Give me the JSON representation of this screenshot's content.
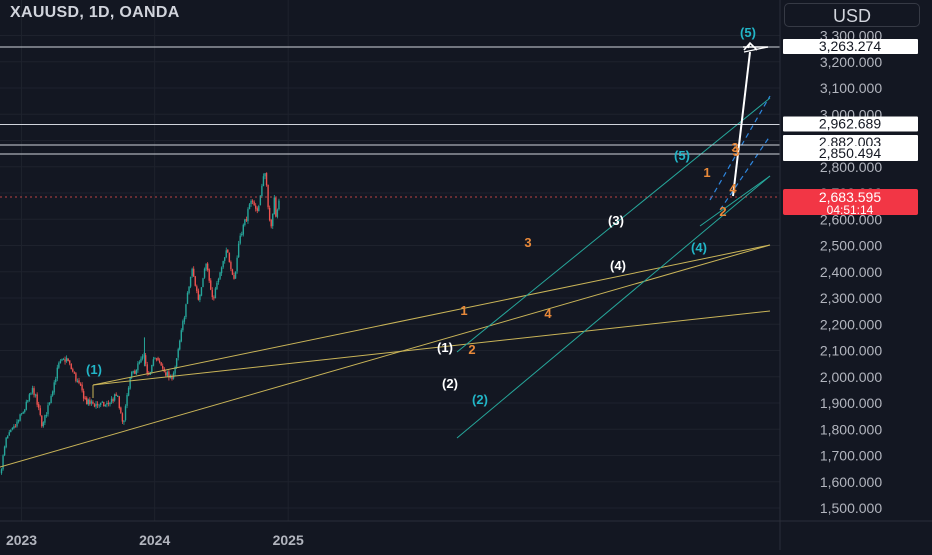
{
  "header": {
    "symbol_title": "XAUUSD, 1D, OANDA",
    "currency_label": "USD"
  },
  "colors": {
    "background": "#131722",
    "grid": "#1e222d",
    "text": "#b2b5be",
    "candle_up": "#26a69a",
    "candle_down": "#ef5350",
    "yellow_channel": "#c9b458",
    "teal_channel": "#26a69a",
    "projection": "#ffffff",
    "price_badge": "#f23645",
    "wave_cyan": "#22b5c7",
    "wave_white": "#ffffff",
    "wave_orange": "#e8893a"
  },
  "price_axis": {
    "ticks": [
      "3,300.000",
      "3,200.000",
      "3,100.000",
      "3,000.000",
      "2,900.000",
      "2,800.000",
      "2,700.000",
      "2,600.000",
      "2,500.000",
      "2,400.000",
      "2,300.000",
      "2,200.000",
      "2,100.000",
      "2,000.000",
      "1,900.000",
      "1,800.000",
      "1,700.000",
      "1,600.000",
      "1,500.000"
    ]
  },
  "time_axis": {
    "ticks": [
      "2023",
      "2024",
      "2025"
    ]
  },
  "level_labels": [
    {
      "name": "target-level",
      "text": "3,263.274",
      "value": 3263.274
    },
    {
      "name": "level-2962",
      "text": "2,962.689",
      "value": 2962.689
    },
    {
      "name": "level-2882",
      "text": "2,882.003",
      "value": 2882.003
    },
    {
      "name": "level-2850",
      "text": "2,850.494",
      "value": 2850.494
    }
  ],
  "last_price": {
    "price": "2,683.595",
    "countdown": "04:51:14",
    "value": 2683.595
  },
  "chart_data": {
    "type": "candlestick",
    "title": "XAUUSD, 1D, OANDA",
    "xlabel": "",
    "ylabel": "",
    "x_ticks": [
      "2023",
      "2024",
      "2025"
    ],
    "ylim": [
      1450,
      3360
    ],
    "price_path": [
      [
        "2022-11-03",
        1630
      ],
      [
        "2022-11-20",
        1760
      ],
      [
        "2022-12-15",
        1810
      ],
      [
        "2023-01-10",
        1880
      ],
      [
        "2023-02-02",
        1955
      ],
      [
        "2023-02-28",
        1810
      ],
      [
        "2023-04-13",
        2045
      ],
      [
        "2023-05-04",
        2070
      ],
      [
        "2023-06-30",
        1900
      ],
      [
        "2023-08-20",
        1890
      ],
      [
        "2023-09-20",
        1930
      ],
      [
        "2023-10-05",
        1815
      ],
      [
        "2023-10-27",
        2000
      ],
      [
        "2023-12-04",
        2080
      ],
      [
        "2023-12-13",
        1980
      ],
      [
        "2023-12-28",
        2080
      ],
      [
        "2024-02-14",
        1990
      ],
      [
        "2024-02-29",
        2050
      ],
      [
        "2024-04-12",
        2410
      ],
      [
        "2024-05-01",
        2290
      ],
      [
        "2024-05-20",
        2450
      ],
      [
        "2024-06-07",
        2290
      ],
      [
        "2024-07-17",
        2480
      ],
      [
        "2024-08-07",
        2370
      ],
      [
        "2024-08-20",
        2530
      ],
      [
        "2024-09-26",
        2680
      ],
      [
        "2024-10-07",
        2620
      ],
      [
        "2024-10-30",
        2790
      ],
      [
        "2024-11-14",
        2540
      ],
      [
        "2024-11-25",
        2710
      ],
      [
        "2024-11-28",
        2620
      ],
      [
        "2024-12-10",
        2683.595
      ]
    ],
    "horizontal_levels": [
      3263.274,
      2962.689,
      2882.003,
      2850.494
    ],
    "last_price": 2683.595,
    "price_scale_label": "USD"
  },
  "wave_labels": [
    {
      "text": "(1)",
      "color": "cyan",
      "anchor": "2023-02-02",
      "price": 2010
    },
    {
      "text": "(2)",
      "color": "cyan",
      "anchor": "2024-03-01",
      "price": 1900
    },
    {
      "text": "(4)",
      "color": "cyan",
      "anchor": "2024-11-12",
      "price": 2480
    },
    {
      "text": "(5)",
      "color": "cyan",
      "anchor": "2024-12-15",
      "price": 3300
    },
    {
      "text": "(5)",
      "color": "cyan",
      "anchor": "2024-10-28",
      "price": 2820
    },
    {
      "text": "(1)",
      "color": "white",
      "anchor": "2024-02-20",
      "price": 2100
    },
    {
      "text": "(2)",
      "color": "white",
      "anchor": "2024-02-20",
      "price": 1970
    },
    {
      "text": "(3)",
      "color": "white",
      "anchor": "2024-08-20",
      "price": 2590
    },
    {
      "text": "(4)",
      "color": "white",
      "anchor": "2024-09-01",
      "price": 2410
    },
    {
      "text": "1",
      "color": "orange",
      "anchor": "2024-03-05",
      "price": 2250
    },
    {
      "text": "2",
      "color": "orange",
      "anchor": "2024-03-09",
      "price": 2100
    },
    {
      "text": "3",
      "color": "orange",
      "anchor": "2024-05-10",
      "price": 2500
    },
    {
      "text": "4",
      "color": "orange",
      "anchor": "2024-06-20",
      "price": 2260
    },
    {
      "text": "1",
      "color": "orange",
      "anchor": "2024-11-20",
      "price": 2740
    },
    {
      "text": "2",
      "color": "orange",
      "anchor": "2024-12-10",
      "price": 2620
    },
    {
      "text": "3",
      "color": "orange",
      "anchor": "2024-12-10",
      "price": 2840
    },
    {
      "text": "3",
      "color": "orange",
      "anchor": "2024-12-06",
      "price": 2880
    },
    {
      "text": "4",
      "color": "orange",
      "anchor": "2024-12-13",
      "price": 2690
    }
  ]
}
